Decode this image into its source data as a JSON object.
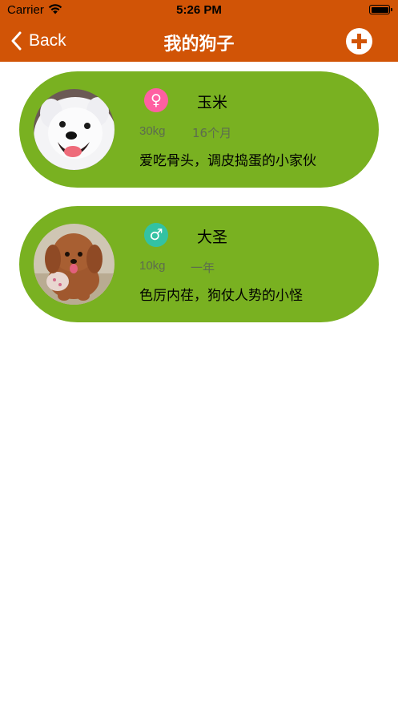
{
  "status_bar": {
    "carrier": "Carrier",
    "time": "5:26 PM"
  },
  "nav": {
    "back_label": "Back",
    "title": "我的狗子",
    "add_icon": "plus-circle-icon",
    "color": "#d15406"
  },
  "dogs": [
    {
      "name": "玉米",
      "weight": "30kg",
      "age": "16个月",
      "description": "爱吃骨头，调皮捣蛋的小家伙",
      "gender": "female",
      "gender_symbol": "♀",
      "gender_color": "#ff5fa2",
      "photo": "white-samoyed-photo"
    },
    {
      "name": "大圣",
      "weight": "10kg",
      "age": "一年",
      "description": "色厉内荏，狗仗人势的小怪",
      "gender": "male",
      "gender_symbol": "♂",
      "gender_color": "#33c2a3",
      "photo": "brown-poodle-photo"
    }
  ],
  "card_color": "#79b121"
}
